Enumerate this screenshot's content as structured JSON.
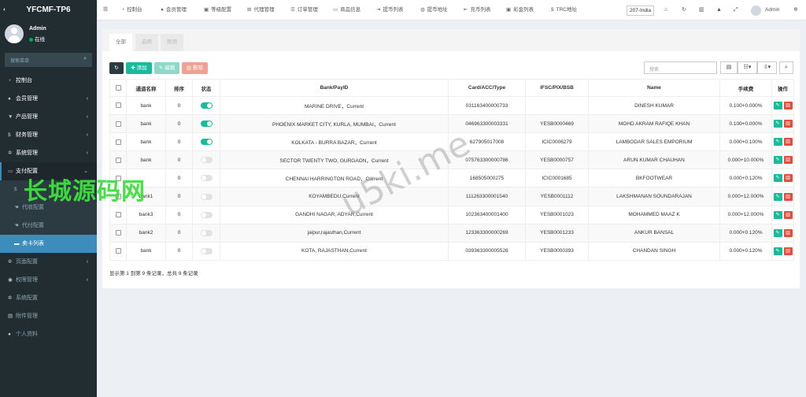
{
  "brand": {
    "title": "YFCMF-TP6"
  },
  "user": {
    "name": "Admin",
    "status": "在线"
  },
  "sidebar": {
    "search_placeholder": "搜索菜单",
    "items": [
      {
        "label": "控制台",
        "icon": "dashboard-icon",
        "arrow": ""
      },
      {
        "label": "会员管理",
        "icon": "user-icon",
        "arrow": "‹"
      },
      {
        "label": "产品管理",
        "icon": "shopping-cart-icon",
        "arrow": "‹"
      },
      {
        "label": "财务管理",
        "icon": "money-icon",
        "arrow": "‹"
      },
      {
        "label": "系统管理",
        "icon": "cogs-icon",
        "arrow": "‹"
      },
      {
        "label": "支付配置",
        "icon": "credit-card-icon",
        "arrow": "⌄"
      },
      {
        "label": "",
        "icon": "dollar-icon",
        "arrow": ""
      },
      {
        "label": "代收配置",
        "icon": "hand-icon",
        "arrow": ""
      },
      {
        "label": "代付配置",
        "icon": "hand-icon",
        "arrow": ""
      },
      {
        "label": "卖卡列表",
        "icon": "list-icon",
        "arrow": ""
      },
      {
        "label": "页面配置",
        "icon": "page-icon",
        "arrow": "‹"
      },
      {
        "label": "权限管理",
        "icon": "group-icon",
        "arrow": "‹"
      },
      {
        "label": "系统配置",
        "icon": "cog-icon",
        "arrow": ""
      },
      {
        "label": "附件管理",
        "icon": "file-icon",
        "arrow": ""
      },
      {
        "label": "个人资料",
        "icon": "user-icon",
        "arrow": ""
      }
    ]
  },
  "topnav": {
    "items": [
      "控制台",
      "会员管理",
      "等级配置",
      "代理管理",
      "订单管理",
      "商品信息",
      "提币列表",
      "提币地址",
      "充币列表",
      "彩金列表",
      "TRC地址"
    ],
    "lang": "207-India",
    "admin": "Admin"
  },
  "tabs": [
    "全部",
    "启用",
    "禁用"
  ],
  "toolbar": {
    "add": "添加",
    "edit": "编辑",
    "delete": "删除",
    "search_placeholder": "搜索"
  },
  "table": {
    "headers": [
      "通道名称",
      "排序",
      "状态",
      "Bank/PayID",
      "Card/ACC/Type",
      "IFSC/PIX/BSB",
      "Name",
      "手续费",
      "操作"
    ],
    "rows": [
      {
        "channel": "bank",
        "sort": "0",
        "status": true,
        "bank": "MARINE DRIVE，Current",
        "card": "031163400000733",
        "ifsc": "",
        "name": "DINESH KUMAR",
        "fee": "0.100+0.000%"
      },
      {
        "channel": "bank",
        "sort": "0",
        "status": true,
        "bank": "PHOENIX MARKET CITY, KURLA, MUMBAI，Current",
        "card": "046963300003331",
        "ifsc": "YESB0000469",
        "name": "MOHD AKRAM RAFIQE KHAN",
        "fee": "0.100+0.000%"
      },
      {
        "channel": "bank",
        "sort": "0",
        "status": true,
        "bank": "KOLKATA - BURRA BAZAR，Current",
        "card": "627905017008",
        "ifsc": "ICIC0006279",
        "name": "LAMBODAR SALES EMPORIUM",
        "fee": "0.000+0.100%"
      },
      {
        "channel": "bank",
        "sort": "0",
        "status": false,
        "bank": "SECTOR TWENTY TWO, GURGAON，Current",
        "card": "075763300000786",
        "ifsc": "YESB0000757",
        "name": "ARUN KUMAR CHAUHAN",
        "fee": "0.000+10.000%"
      },
      {
        "channel": "",
        "sort": "0",
        "status": false,
        "bank": "CHENNAI HARRINGTON ROAD，Current",
        "card": "168505000275",
        "ifsc": "ICIC0001685",
        "name": "BKFOOTWEAR",
        "fee": "0.000+0.120%"
      },
      {
        "channel": "bank1",
        "sort": "0",
        "status": false,
        "bank": "KOYAMBEDU,Current",
        "card": "111263300001540",
        "ifsc": "YESB0001112",
        "name": "LAKSHMANAN SOUNDARAJAN",
        "fee": "0.000+12.000%"
      },
      {
        "channel": "bank3",
        "sort": "0",
        "status": false,
        "bank": "GANDHI NAGAR, ADYAR,Current",
        "card": "102363400001400",
        "ifsc": "YESB0001023",
        "name": "MOHAMMED MAAZ K",
        "fee": "0.000+12.000%"
      },
      {
        "channel": "bank2",
        "sort": "0",
        "status": false,
        "bank": "jaipur,rajasthan,Current",
        "card": "123363300000269",
        "ifsc": "YESB0001233",
        "name": "ANKUR BANSAL",
        "fee": "0.000+0.120%"
      },
      {
        "channel": "bank",
        "sort": "0",
        "status": false,
        "bank": "KOTA, RAJASTHAN,Current",
        "card": "039363300005526",
        "ifsc": "YESB0000393",
        "name": "CHANDAN SINGH",
        "fee": "0.000+0.120%"
      }
    ]
  },
  "summary": "显示第 1 到第 9 条记录，总共 9 条记录",
  "watermark": {
    "cn": "长城源码网",
    "en": "u5ki.me"
  }
}
